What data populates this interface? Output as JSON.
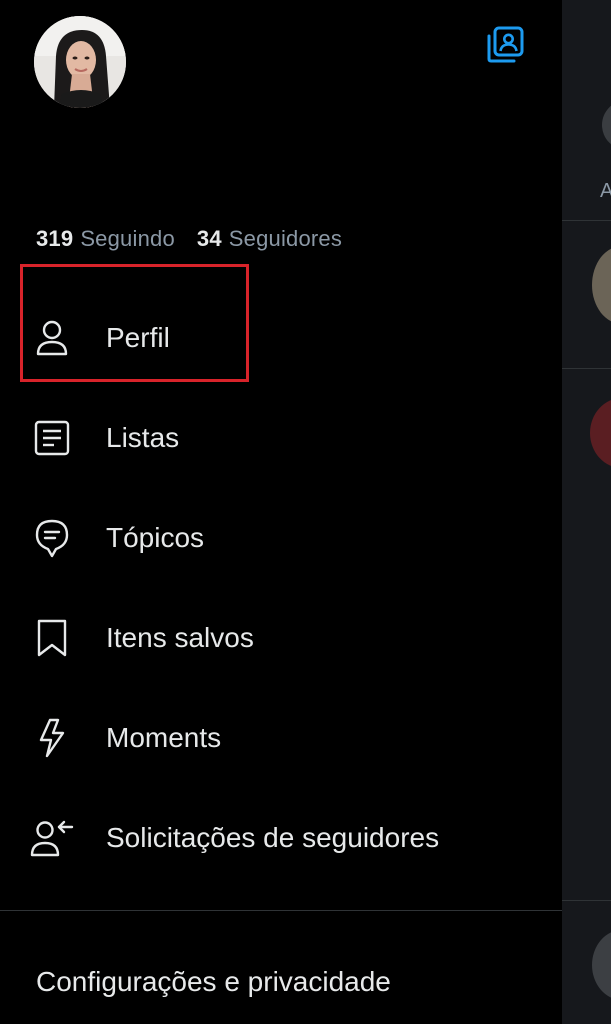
{
  "profile": {
    "avatar_icon": "user-photo"
  },
  "header": {
    "accounts_icon": "switch-accounts-icon",
    "accent_color": "#1d9bf0"
  },
  "stats": {
    "following_count": "319",
    "following_label": "Seguindo",
    "followers_count": "34",
    "followers_label": "Seguidores"
  },
  "menu": {
    "items": [
      {
        "label": "Perfil",
        "icon": "person-icon"
      },
      {
        "label": "Listas",
        "icon": "list-icon"
      },
      {
        "label": "Tópicos",
        "icon": "topics-icon"
      },
      {
        "label": "Itens salvos",
        "icon": "bookmark-icon"
      },
      {
        "label": "Moments",
        "icon": "lightning-icon"
      },
      {
        "label": "Solicitações de seguidores",
        "icon": "follower-request-icon"
      }
    ]
  },
  "footer": {
    "settings_label": "Configurações e privacidade"
  },
  "peek": {
    "letter": "A"
  },
  "colors": {
    "highlight": "#d8232a",
    "text": "#e7e9ea",
    "muted": "#8b98a5",
    "background": "#000000"
  }
}
